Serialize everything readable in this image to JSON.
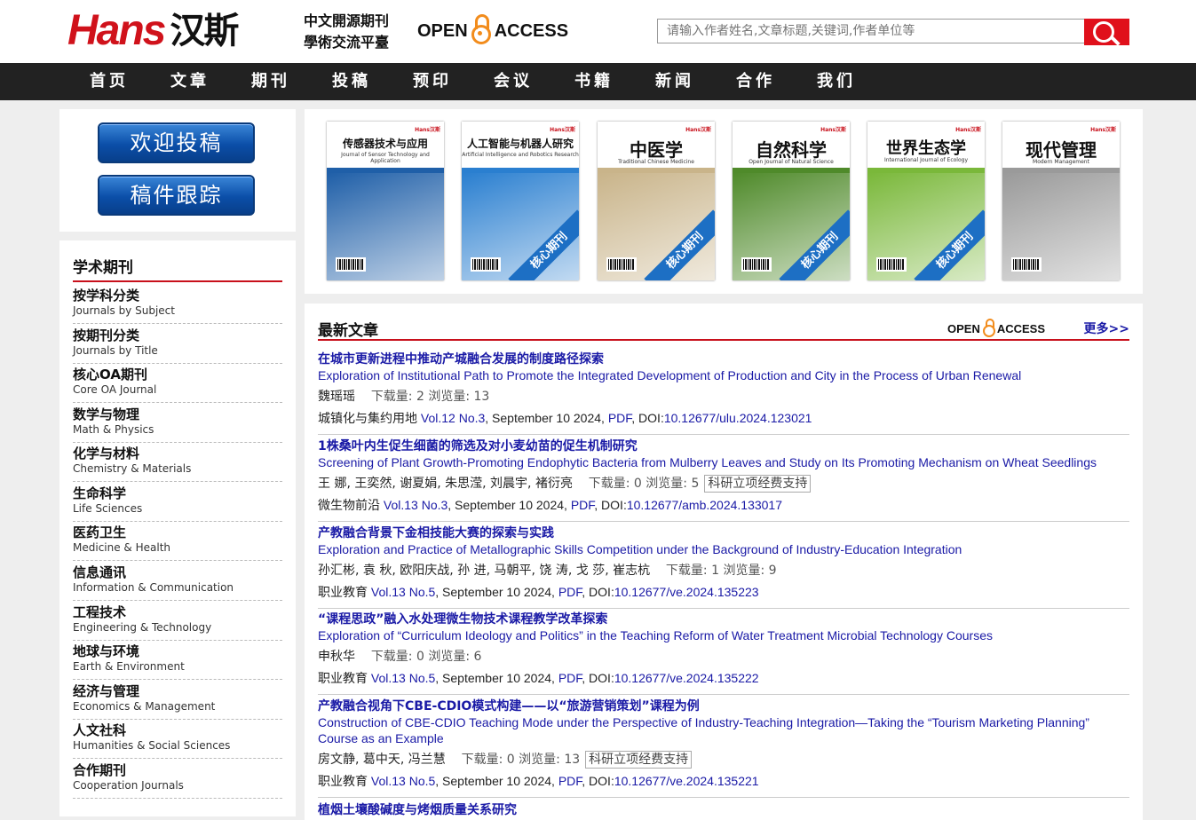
{
  "header": {
    "logo_en": "Hans",
    "logo_cn": "汉斯",
    "slogan_line1": "中文開源期刊",
    "slogan_line2": "學術交流平臺",
    "oa_open": "OPEN",
    "oa_access": "ACCESS",
    "search_placeholder": "请输入作者姓名,文章标题,关键词,作者单位等"
  },
  "nav": [
    "首页",
    "文章",
    "期刊",
    "投稿",
    "预印",
    "会议",
    "书籍",
    "新闻",
    "合作",
    "我们"
  ],
  "left": {
    "submit_button": "欢迎投稿",
    "track_button": "稿件跟踪",
    "list_title": "学术期刊",
    "categories": [
      {
        "cn": "按学科分类",
        "en": "Journals by Subject"
      },
      {
        "cn": "按期刊分类",
        "en": "Journals by Title"
      },
      {
        "cn": "核心OA期刊",
        "en": "Core OA Journal"
      },
      {
        "cn": "数学与物理",
        "en": "Math & Physics"
      },
      {
        "cn": "化学与材料",
        "en": "Chemistry & Materials"
      },
      {
        "cn": "生命科学",
        "en": "Life Sciences"
      },
      {
        "cn": "医药卫生",
        "en": "Medicine & Health"
      },
      {
        "cn": "信息通讯",
        "en": "Information & Communication"
      },
      {
        "cn": "工程技术",
        "en": "Engineering & Technology"
      },
      {
        "cn": "地球与环境",
        "en": "Earth & Environment"
      },
      {
        "cn": "经济与管理",
        "en": "Economics & Management"
      },
      {
        "cn": "人文社科",
        "en": "Humanities & Social Sciences"
      },
      {
        "cn": "合作期刊",
        "en": "Cooperation Journals"
      }
    ]
  },
  "covers": [
    {
      "cn": "传感器技术与应用",
      "en": "Journal of Sensor Technology and Application",
      "ribbon": "",
      "color": "#1f5fa8"
    },
    {
      "cn": "人工智能与机器人研究",
      "en": "Artificial Intelligence and Robotics Research",
      "ribbon": "核心期刊",
      "color": "#2a7fd0"
    },
    {
      "cn": "中医学",
      "en": "Traditional Chinese Medicine",
      "ribbon": "核心期刊",
      "color": "#c9b48a"
    },
    {
      "cn": "自然科学",
      "en": "Open Journal of Natural Science",
      "ribbon": "核心期刊",
      "color": "#4f8a2a"
    },
    {
      "cn": "世界生态学",
      "en": "International Journal of Ecology",
      "ribbon": "核心期刊",
      "color": "#7ab83a"
    },
    {
      "cn": "现代管理",
      "en": "Modern Management",
      "ribbon": "",
      "color": "#9a9a9a"
    }
  ],
  "cover_brand": "Hans汉斯",
  "articles": {
    "title": "最新文章",
    "oa_open": "OPEN",
    "oa_access": "ACCESS",
    "more": "更多>>",
    "items": [
      {
        "zh": "在城市更新进程中推动产城融合发展的制度路径探索",
        "en": "Exploration of Institutional Path to Promote the Integrated Development of Production and City in the Process of Urban Renewal",
        "authors": "魏瑶瑶",
        "stats": "下载量: 2  浏览量: 13",
        "badge": "",
        "journal": "城镇化与集约用地",
        "vol": "Vol.12 No.3",
        "date": ", September 10 2024, ",
        "pdf": "PDF",
        "doi_label": ", DOI:",
        "doi": "10.12677/ulu.2024.123021"
      },
      {
        "zh": "1株桑叶内生促生细菌的筛选及对小麦幼苗的促生机制研究",
        "en": "Screening of Plant Growth-Promoting Endophytic Bacteria from Mulberry Leaves and Study on Its Promoting Mechanism on Wheat Seedlings",
        "authors": "王 娜, 王奕然, 谢夏娟, 朱思滢, 刘晨宇, 褚衍亮",
        "stats": "下载量: 0  浏览量: 5",
        "badge": "科研立项经费支持",
        "journal": "微生物前沿",
        "vol": "Vol.13 No.3",
        "date": ", September 10 2024, ",
        "pdf": "PDF",
        "doi_label": ", DOI:",
        "doi": "10.12677/amb.2024.133017"
      },
      {
        "zh": "产教融合背景下金相技能大赛的探索与实践",
        "en": "Exploration and Practice of Metallographic Skills Competition under the Background of Industry-Education Integration",
        "authors": "孙汇彬, 袁 秋, 欧阳庆战, 孙 进, 马朝平, 饶 涛, 戈 莎, 崔志杭",
        "stats": "下载量: 1  浏览量: 9",
        "badge": "",
        "journal": "职业教育",
        "vol": "Vol.13 No.5",
        "date": ", September 10 2024, ",
        "pdf": "PDF",
        "doi_label": ", DOI:",
        "doi": "10.12677/ve.2024.135223"
      },
      {
        "zh": "“课程思政”融入水处理微生物技术课程教学改革探索",
        "en": "Exploration of “Curriculum Ideology and Politics” in the Teaching Reform of Water Treatment Microbial Technology Courses",
        "authors": "申秋华",
        "stats": "下载量: 0  浏览量: 6",
        "badge": "",
        "journal": "职业教育",
        "vol": "Vol.13 No.5",
        "date": ", September 10 2024, ",
        "pdf": "PDF",
        "doi_label": ", DOI:",
        "doi": "10.12677/ve.2024.135222"
      },
      {
        "zh": "产教融合视角下CBE-CDIO模式构建——以“旅游营销策划”课程为例",
        "en": "Construction of CBE-CDIO Teaching Mode under the Perspective of Industry-Teaching Integration—Taking the “Tourism Marketing Planning” Course as an Example",
        "authors": "房文静, 葛中天, 冯兰慧",
        "stats": "下载量: 0  浏览量: 13",
        "badge": "科研立项经费支持",
        "journal": "职业教育",
        "vol": "Vol.13 No.5",
        "date": ", September 10 2024, ",
        "pdf": "PDF",
        "doi_label": ", DOI:",
        "doi": "10.12677/ve.2024.135221"
      },
      {
        "zh": "植烟土壤酸碱度与烤烟质量关系研究",
        "en": "",
        "authors": "",
        "stats": "",
        "badge": "",
        "journal": "",
        "vol": "",
        "date": "",
        "pdf": "",
        "doi_label": "",
        "doi": ""
      }
    ]
  }
}
